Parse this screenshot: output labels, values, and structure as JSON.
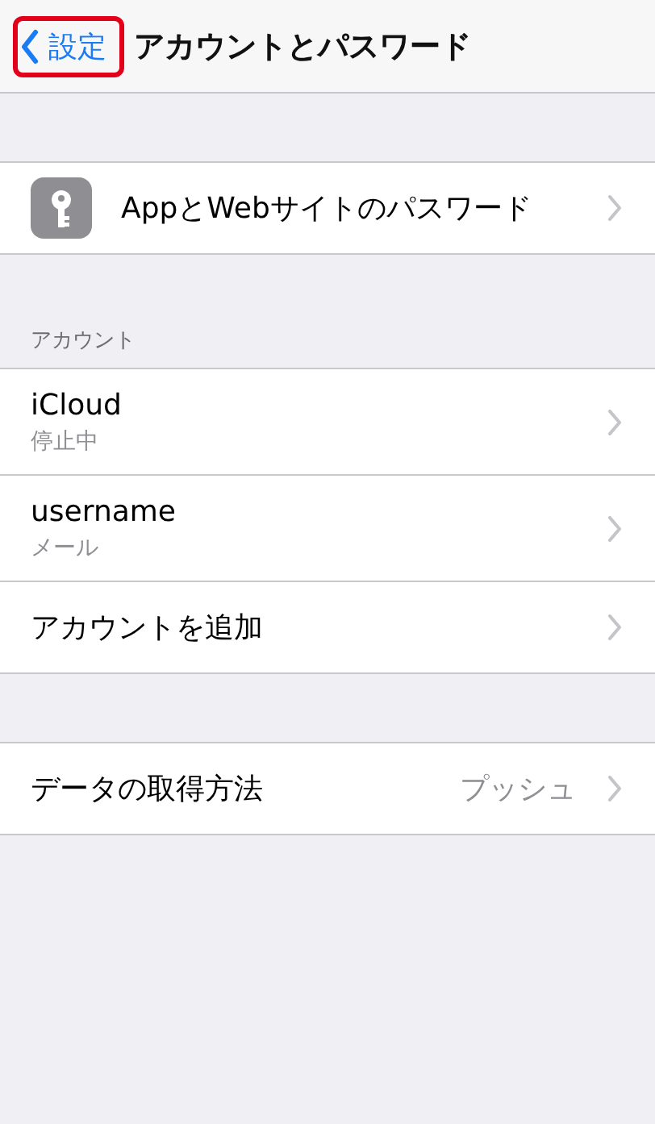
{
  "nav_bar": {
    "back_button": {
      "label": "設定",
      "highlighted": true
    },
    "title": "アカウントとパスワード"
  },
  "sections": [
    {
      "rows": [
        {
          "kind": "icon",
          "title": "AppとWebサイトのパスワード"
        }
      ]
    },
    {
      "header": "アカウント",
      "rows": [
        {
          "kind": "subtitle",
          "title": "iCloud",
          "subtitle": "停止中"
        },
        {
          "kind": "subtitle",
          "title": "username",
          "subtitle": "メール"
        },
        {
          "kind": "plain",
          "title": "アカウントを追加"
        }
      ]
    },
    {
      "rows": [
        {
          "kind": "value",
          "title": "データの取得方法",
          "value": "プッシュ"
        }
      ]
    }
  ]
}
